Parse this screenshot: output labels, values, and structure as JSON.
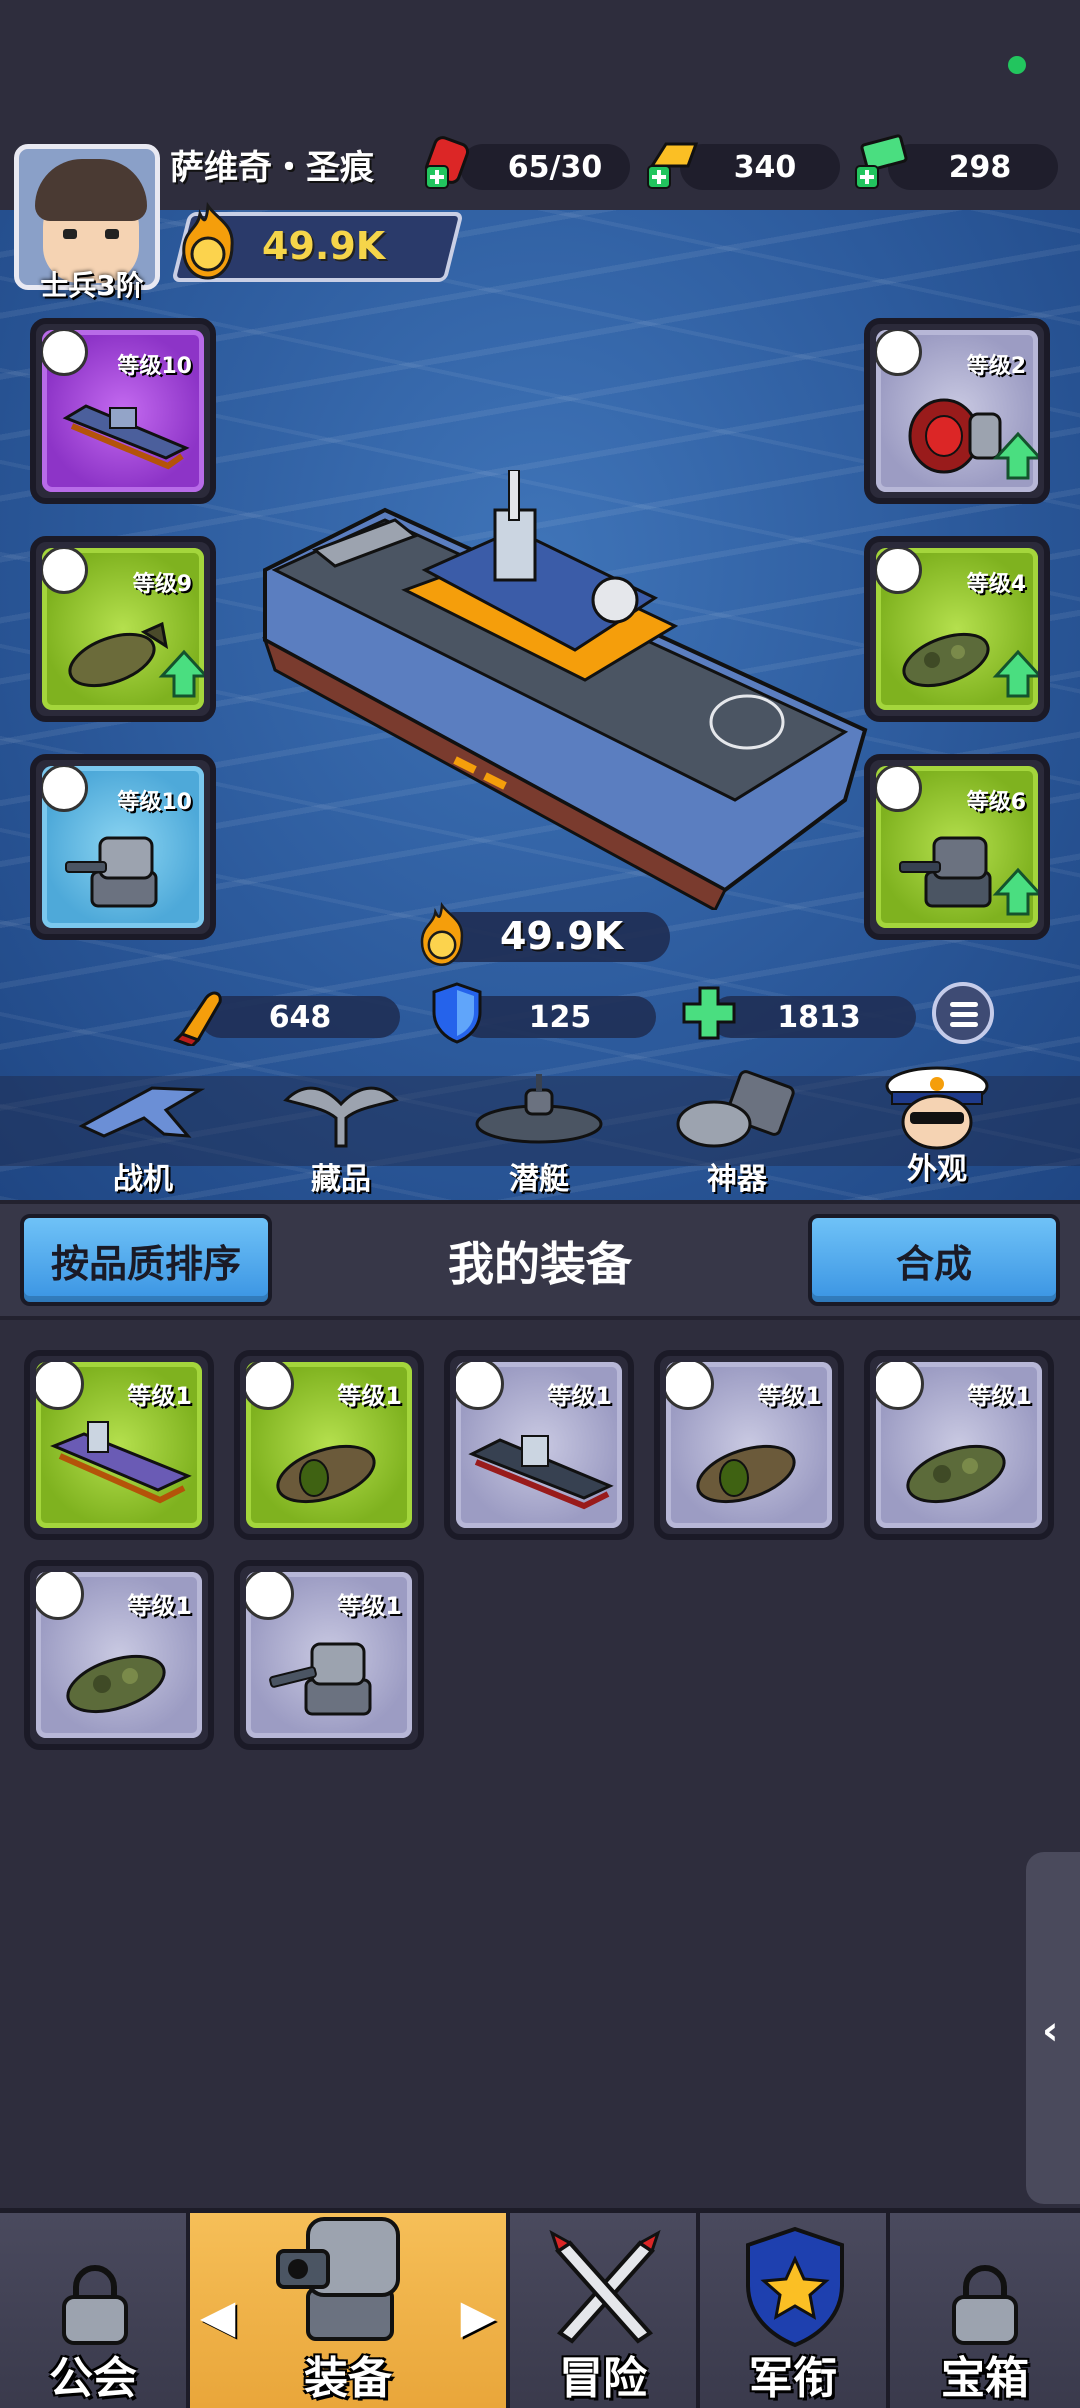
{
  "player": {
    "name": "萨维奇・圣痕",
    "rank": "士兵3阶",
    "power": "49.9K"
  },
  "resources": {
    "stamina": "65/30",
    "gold": "340",
    "cash": "298"
  },
  "slots_left": [
    {
      "level": "等级10",
      "quality": "purple",
      "type": "ship-icon"
    },
    {
      "level": "等级9",
      "quality": "green",
      "type": "torpedo-icon",
      "upgrade": true
    },
    {
      "level": "等级10",
      "quality": "blue",
      "type": "turret-icon"
    }
  ],
  "slots_right": [
    {
      "level": "等级2",
      "quality": "grey",
      "type": "engine-icon",
      "upgrade": true
    },
    {
      "level": "等级4",
      "quality": "green",
      "type": "torpedo-icon",
      "upgrade": true
    },
    {
      "level": "等级6",
      "quality": "green",
      "type": "turret-icon",
      "upgrade": true
    }
  ],
  "ship": {
    "power": "49.9K",
    "attack": "648",
    "defense": "125",
    "hp": "1813"
  },
  "functions": {
    "fighter": "战机",
    "collection": "藏品",
    "submarine": "潜艇",
    "artifact": "神器",
    "appearance": "外观"
  },
  "panel": {
    "sort_button": "按品质排序",
    "title": "我的装备",
    "merge_button": "合成"
  },
  "inventory": [
    {
      "level": "等级1",
      "quality": "green",
      "type": "ship-icon",
      "item": "carrier"
    },
    {
      "level": "等级1",
      "quality": "green",
      "type": "torpedo-icon",
      "item": "torpedo"
    },
    {
      "level": "等级1",
      "quality": "grey",
      "type": "ship-icon",
      "item": "battleship"
    },
    {
      "level": "等级1",
      "quality": "grey",
      "type": "torpedo-icon",
      "item": "torpedo"
    },
    {
      "level": "等级1",
      "quality": "grey",
      "type": "torpedo-icon",
      "item": "camo-torpedo"
    },
    {
      "level": "等级1",
      "quality": "grey",
      "type": "torpedo-icon",
      "item": "camo-torpedo"
    },
    {
      "level": "等级1",
      "quality": "grey",
      "type": "turret-icon",
      "item": "turret"
    }
  ],
  "nav": {
    "guild": "公会",
    "equipment": "装备",
    "adventure": "冒险",
    "military_rank": "军衔",
    "chest": "宝箱"
  }
}
